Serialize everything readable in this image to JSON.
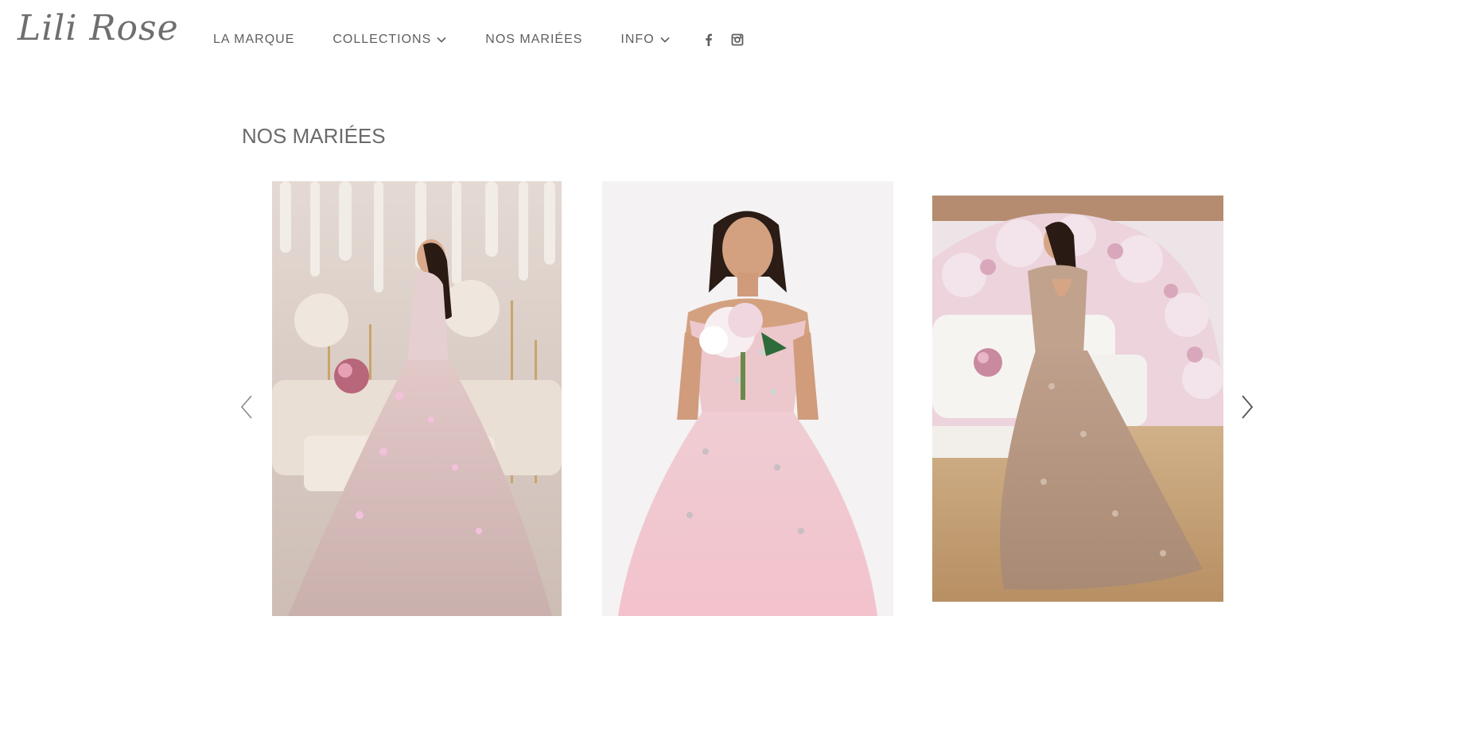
{
  "brand": {
    "logo_text": "Lili Rose"
  },
  "nav": {
    "items": [
      {
        "label": "LA MARQUE",
        "has_dropdown": false
      },
      {
        "label": "COLLECTIONS",
        "has_dropdown": true
      },
      {
        "label": "NOS MARIÉES",
        "has_dropdown": false
      },
      {
        "label": "INFO",
        "has_dropdown": true
      }
    ],
    "social": [
      {
        "icon": "facebook-icon"
      },
      {
        "icon": "instagram-icon"
      }
    ]
  },
  "section": {
    "title": "NOS MARIÉES"
  },
  "carousel": {
    "prev_icon": "chevron-left-icon",
    "next_icon": "chevron-right-icon",
    "slides": [
      {
        "subject": "bride-pink-tulle-gown-profile",
        "palette": {
          "bg": "#d9cbc4",
          "dress": "#d8bfc0",
          "accent": "#e9a9c8"
        }
      },
      {
        "subject": "bride-pink-off-shoulder-gown-front",
        "palette": {
          "bg": "#f3f1f2",
          "dress": "#f1c9cf",
          "accent": "#e8b3be"
        }
      },
      {
        "subject": "bride-gold-lace-gown-back",
        "palette": {
          "bg": "#e9dfe2",
          "dress": "#b89a86",
          "accent": "#e6bcc8"
        }
      }
    ]
  },
  "colors": {
    "text": "#5f5f5f",
    "title": "#6a6a6a",
    "arrow": "#777777"
  }
}
